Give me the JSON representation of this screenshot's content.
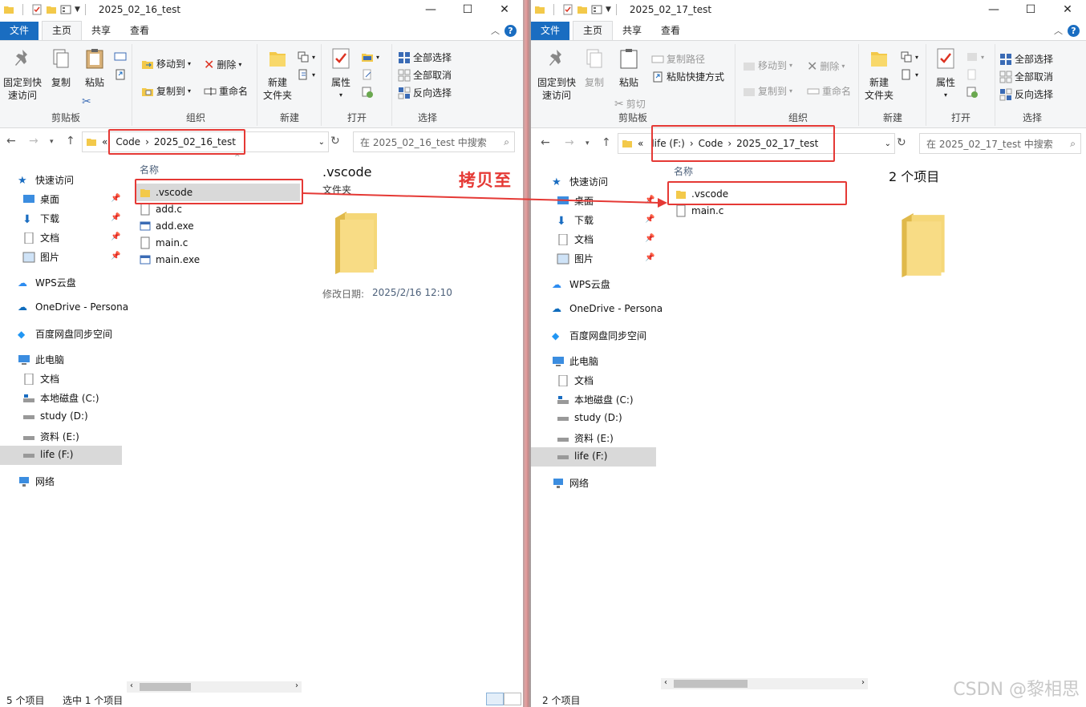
{
  "left": {
    "title": "2025_02_16_test",
    "tabs": {
      "file": "文件",
      "home": "主页",
      "share": "共享",
      "view": "查看"
    },
    "ribbon": {
      "pin": "固定到快\n速访问",
      "copy": "复制",
      "paste": "粘贴",
      "clipboard": "剪贴板",
      "move_to": "移动到",
      "delete": "删除",
      "copy_to": "复制到",
      "rename": "重命名",
      "organize": "组织",
      "new_folder": "新建\n文件夹",
      "new": "新建",
      "properties": "属性",
      "open": "打开",
      "select_all": "全部选择",
      "select_none": "全部取消",
      "invert": "反向选择",
      "select": "选择"
    },
    "breadcrumb": {
      "prefix": "«",
      "c1": "Code",
      "c2": "2025_02_16_test"
    },
    "search_placeholder": "在 2025_02_16_test 中搜索",
    "sidebar": {
      "quick": "快速访问",
      "desktop": "桌面",
      "downloads": "下载",
      "docs": "文档",
      "pics": "图片",
      "wps": "WPS云盘",
      "onedrive": "OneDrive - Persona",
      "baidu": "百度网盘同步空间",
      "pc": "此电脑",
      "pc_docs": "文档",
      "c": "本地磁盘 (C:)",
      "d": "study (D:)",
      "e": "资料 (E:)",
      "f": "life (F:)",
      "net": "网络"
    },
    "col_name": "名称",
    "files": [
      ".vscode",
      "add.c",
      "add.exe",
      "main.c",
      "main.exe"
    ],
    "preview": {
      "name": ".vscode",
      "type": "文件夹",
      "date_label": "修改日期:",
      "date": "2025/2/16 12:10"
    },
    "status_count": "5 个项目",
    "status_sel": "选中 1 个项目"
  },
  "right": {
    "title": "2025_02_17_test",
    "tabs": {
      "file": "文件",
      "home": "主页",
      "share": "共享",
      "view": "查看"
    },
    "ribbon": {
      "pin": "固定到快\n速访问",
      "copy": "复制",
      "paste": "粘贴",
      "copy_path": "复制路径",
      "paste_shortcut": "粘贴快捷方式",
      "cut": "剪切",
      "clipboard": "剪贴板",
      "move_to": "移动到",
      "delete": "删除",
      "copy_to": "复制到",
      "rename": "重命名",
      "organize": "组织",
      "new_folder": "新建\n文件夹",
      "new": "新建",
      "properties": "属性",
      "open": "打开",
      "select_all": "全部选择",
      "select_none": "全部取消",
      "invert": "反向选择",
      "select": "选择"
    },
    "breadcrumb": {
      "prefix": "«",
      "c0": "life (F:)",
      "c1": "Code",
      "c2": "2025_02_17_test"
    },
    "search_placeholder": "在 2025_02_17_test 中搜索",
    "sidebar": {
      "quick": "快速访问",
      "desktop": "桌面",
      "downloads": "下载",
      "docs": "文档",
      "pics": "图片",
      "wps": "WPS云盘",
      "onedrive": "OneDrive - Persona",
      "baidu": "百度网盘同步空间",
      "pc": "此电脑",
      "pc_docs": "文档",
      "c": "本地磁盘 (C:)",
      "d": "study (D:)",
      "e": "资料 (E:)",
      "f": "life (F:)",
      "net": "网络"
    },
    "col_name": "名称",
    "files": [
      ".vscode",
      "main.c"
    ],
    "preview_count": "2 个项目",
    "status_count": "2 个项目"
  },
  "annotation": "拷贝至",
  "watermark": "CSDN @黎相思"
}
